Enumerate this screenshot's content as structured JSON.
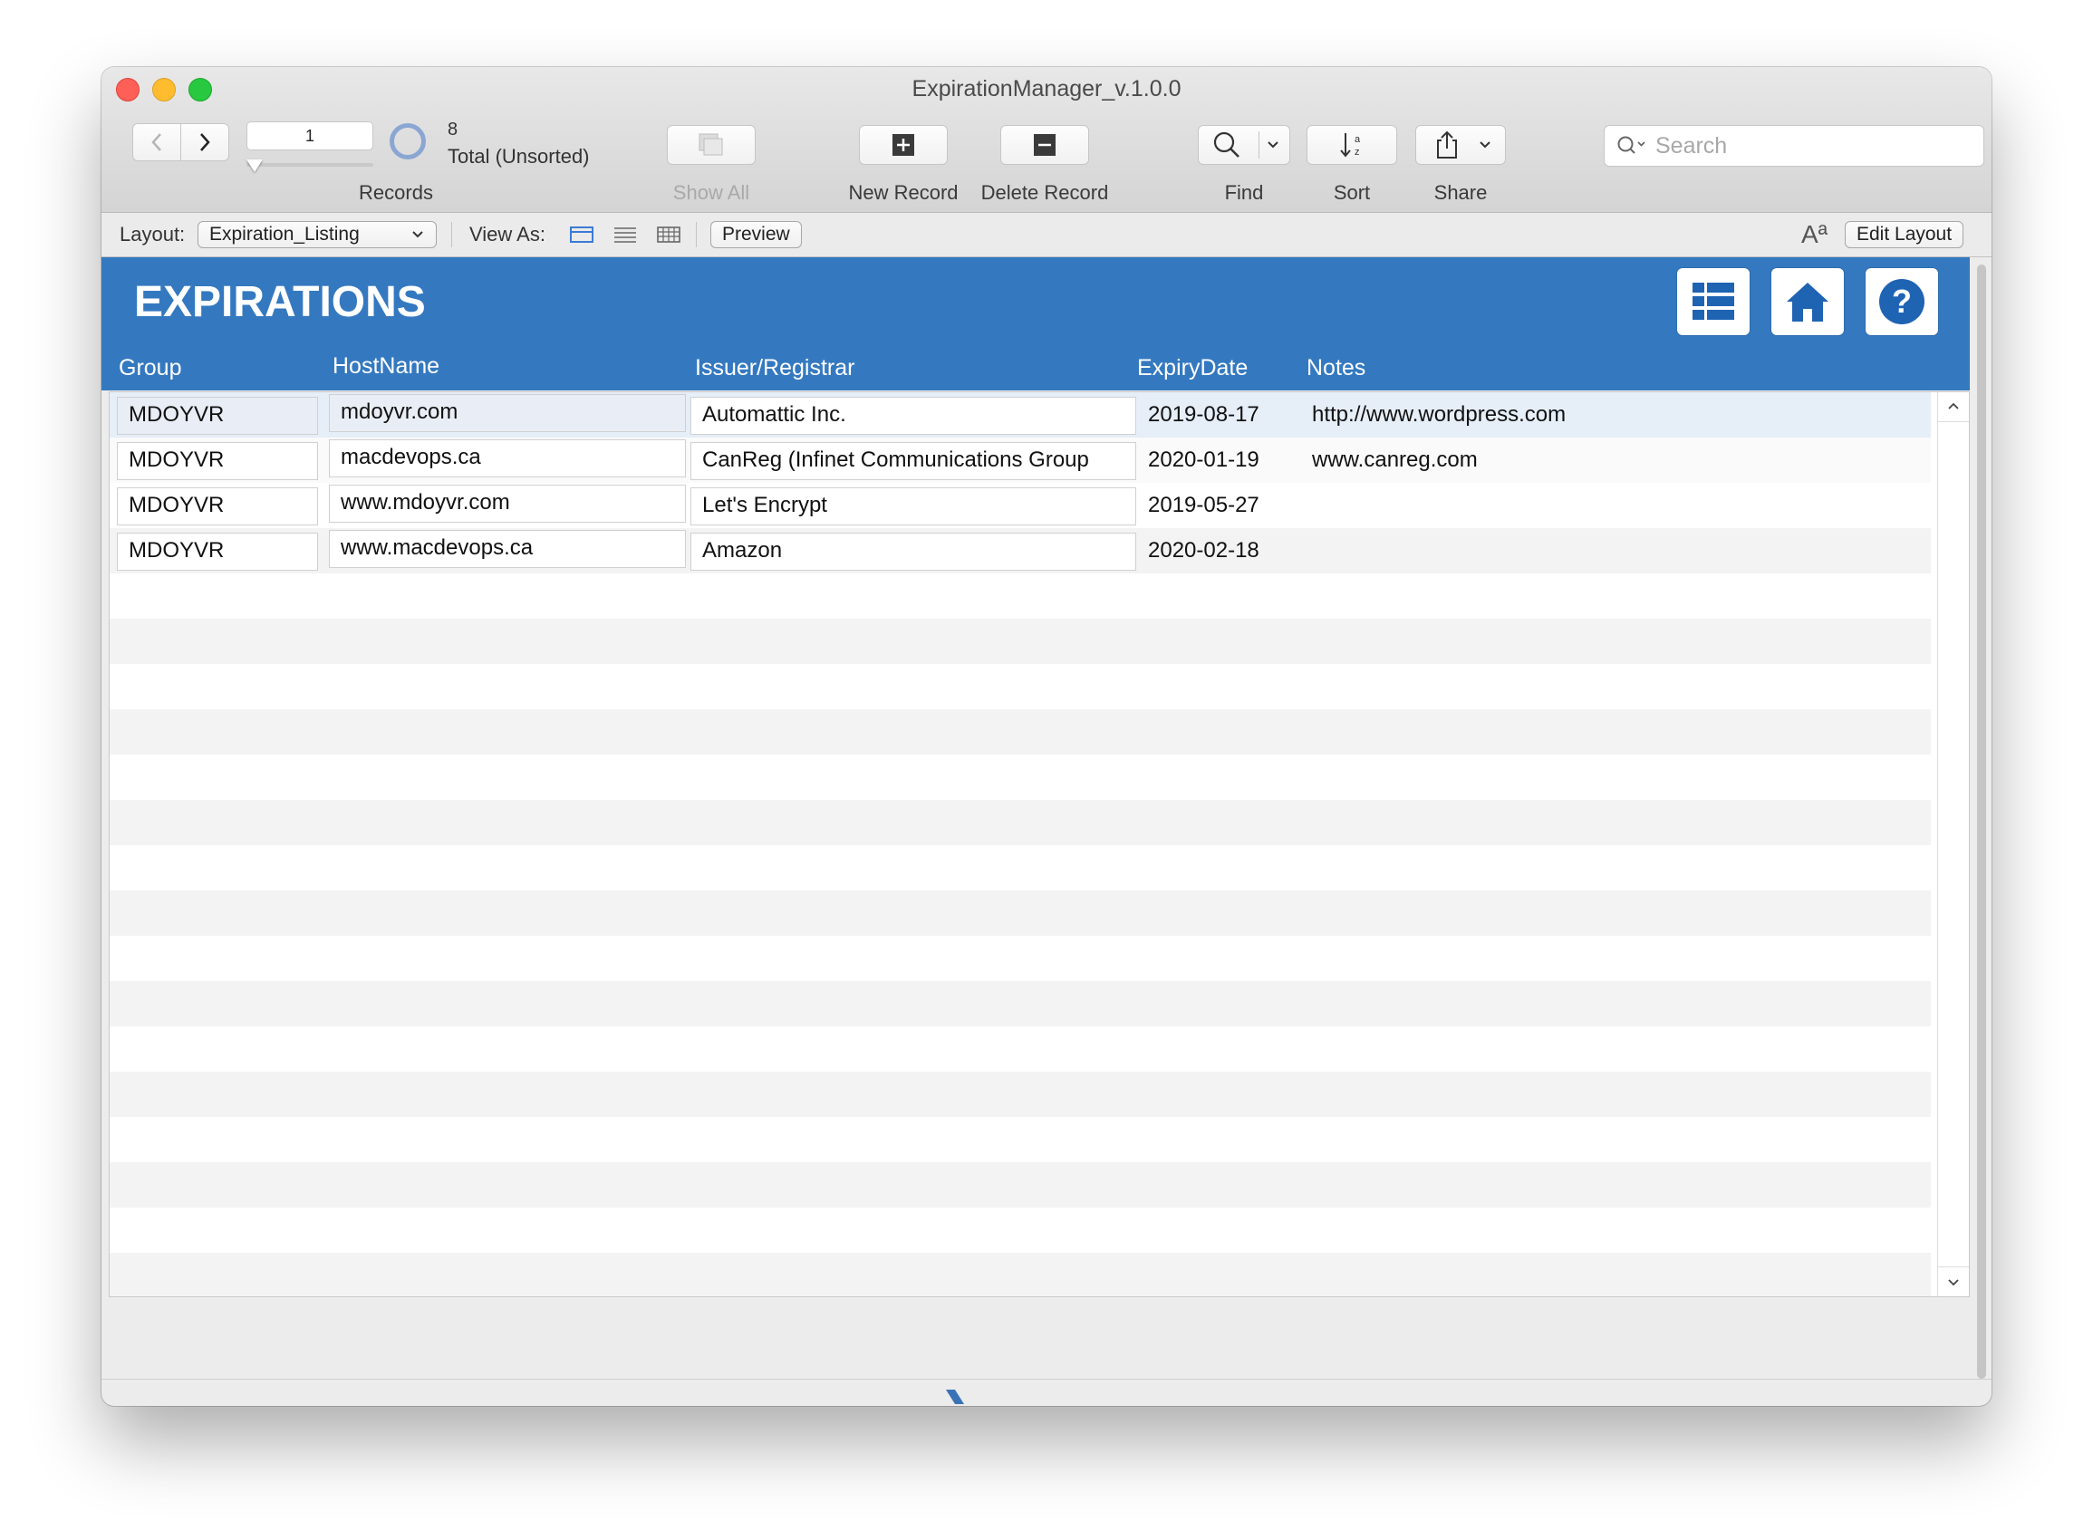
{
  "window": {
    "title": "ExpirationManager_v.1.0.0"
  },
  "toolbar": {
    "record_field_value": "1",
    "records_label": "Records",
    "found_count": "8",
    "total_label": "Total (Unsorted)",
    "show_all_label": "Show All",
    "new_record_label": "New Record",
    "delete_record_label": "Delete Record",
    "find_label": "Find",
    "sort_label": "Sort",
    "share_label": "Share",
    "search_placeholder": "Search"
  },
  "layout_bar": {
    "layout_label": "Layout:",
    "layout_value": "Expiration_Listing",
    "view_as_label": "View As:",
    "preview_label": "Preview",
    "text_size_glyph": "Aª",
    "edit_layout_label": "Edit Layout"
  },
  "header": {
    "title": "EXPIRATIONS",
    "columns": [
      "Group",
      "HostName",
      "Issuer/Registrar",
      "ExpiryDate",
      "Notes"
    ]
  },
  "records": [
    {
      "group": "MDOYVR",
      "hostname": "mdoyvr.com",
      "issuer": "Automattic Inc.",
      "expiry": "2019-08-17",
      "notes": "http://www.wordpress.com"
    },
    {
      "group": "MDOYVR",
      "hostname": "macdevops.ca",
      "issuer": "CanReg (Infinet Communications Group",
      "expiry": "2020-01-19",
      "notes": "www.canreg.com"
    },
    {
      "group": "MDOYVR",
      "hostname": "www.mdoyvr.com",
      "issuer": "Let's Encrypt",
      "expiry": "2019-05-27",
      "notes": ""
    },
    {
      "group": "MDOYVR",
      "hostname": "www.macdevops.ca",
      "issuer": "Amazon",
      "expiry": "2020-02-18",
      "notes": ""
    }
  ],
  "icons": {
    "back": "chevron-left-icon",
    "forward": "chevron-right-icon",
    "show_all": "stacked-pages-icon",
    "new_record": "plus-icon",
    "delete_record": "minus-icon",
    "find": "magnifier-icon",
    "sort": "sort-az-icon",
    "share": "share-icon",
    "grid": "grid-icon",
    "home": "home-icon",
    "help": "question-icon"
  },
  "colors": {
    "header_blue": "#3479c0",
    "selected_row": "#e6eef8"
  }
}
